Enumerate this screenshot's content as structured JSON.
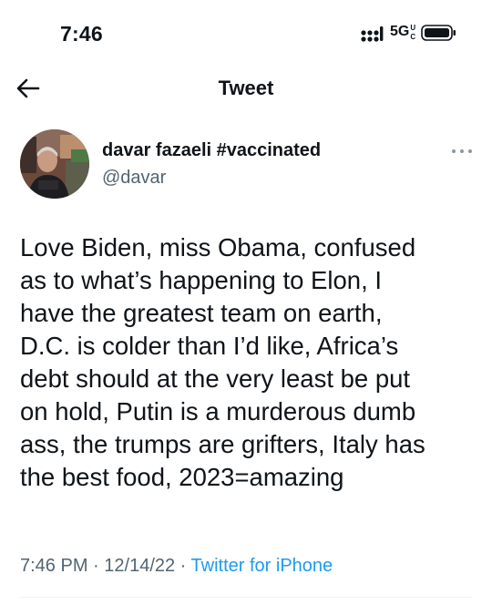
{
  "status_bar": {
    "time": "7:46",
    "network": "5G",
    "network_suffix": "UC"
  },
  "nav": {
    "title": "Tweet",
    "back_icon": "arrow-left-icon"
  },
  "tweet": {
    "author": {
      "display_name": "davar fazaeli #vaccinated",
      "handle": "@davar"
    },
    "text_lines": [
      "Love Biden, miss Obama, confused",
      "as to what’s happening to Elon, I",
      "have the greatest team on earth,",
      "D.C. is colder than I’d like, Africa’s",
      "debt should at the very least be put",
      "on hold, Putin is a murderous dumb",
      "ass, the trumps are grifters, Italy has",
      "the best food, 2023=amazing"
    ],
    "time": "7:46 PM",
    "separator": " · ",
    "date": "12/14/22",
    "source": "Twitter for iPhone"
  },
  "colors": {
    "text_primary": "#0f1419",
    "text_secondary": "#536471",
    "link": "#1d9bf0",
    "divider": "#eff3f4"
  }
}
